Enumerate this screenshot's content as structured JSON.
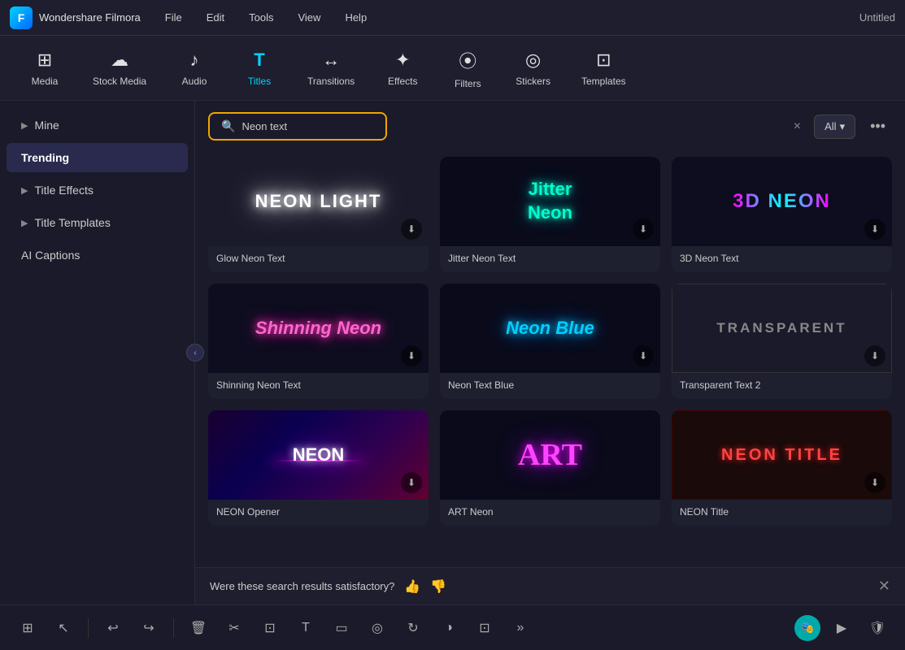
{
  "app": {
    "name": "Wondershare Filmora",
    "window_title": "Untitled"
  },
  "menu": {
    "items": [
      "File",
      "Edit",
      "Tools",
      "View",
      "Help"
    ]
  },
  "toolbar": {
    "items": [
      {
        "id": "media",
        "label": "Media",
        "icon": "⊞"
      },
      {
        "id": "stock-media",
        "label": "Stock Media",
        "icon": "☁"
      },
      {
        "id": "audio",
        "label": "Audio",
        "icon": "♪"
      },
      {
        "id": "titles",
        "label": "Titles",
        "icon": "T",
        "active": true
      },
      {
        "id": "transitions",
        "label": "Transitions",
        "icon": "↔"
      },
      {
        "id": "effects",
        "label": "Effects",
        "icon": "✦"
      },
      {
        "id": "filters",
        "label": "Filters",
        "icon": "⦿"
      },
      {
        "id": "stickers",
        "label": "Stickers",
        "icon": "◎"
      },
      {
        "id": "templates",
        "label": "Templates",
        "icon": "⊡"
      }
    ]
  },
  "sidebar": {
    "items": [
      {
        "id": "mine",
        "label": "Mine",
        "has_chevron": true
      },
      {
        "id": "trending",
        "label": "Trending",
        "active": true
      },
      {
        "id": "title-effects",
        "label": "Title Effects",
        "has_chevron": true
      },
      {
        "id": "title-templates",
        "label": "Title Templates",
        "has_chevron": true
      },
      {
        "id": "ai-captions",
        "label": "AI Captions"
      }
    ]
  },
  "search": {
    "value": "Neon text",
    "placeholder": "Neon text",
    "filter_label": "All",
    "clear_label": "×"
  },
  "grid": {
    "items": [
      {
        "id": "glow-neon",
        "label": "Glow Neon Text",
        "thumb_type": "neon-light"
      },
      {
        "id": "jitter-neon",
        "label": "Jitter Neon Text",
        "thumb_type": "jitter-neon"
      },
      {
        "id": "3d-neon",
        "label": "3D Neon Text",
        "thumb_type": "3d-neon"
      },
      {
        "id": "shinning-neon",
        "label": "Shinning Neon Text",
        "thumb_type": "shinning-neon"
      },
      {
        "id": "neon-blue",
        "label": "Neon Text Blue",
        "thumb_type": "neon-blue"
      },
      {
        "id": "transparent-text",
        "label": "Transparent Text 2",
        "thumb_type": "transparent"
      },
      {
        "id": "neon-opener",
        "label": "NEON Opener",
        "thumb_type": "neon-opener"
      },
      {
        "id": "art-neon",
        "label": "ART Neon",
        "thumb_type": "art"
      },
      {
        "id": "neon-title",
        "label": "NEON Title",
        "thumb_type": "neon-title"
      }
    ]
  },
  "feedback": {
    "text": "Were these search results satisfactory?",
    "thumbs_up": "👍",
    "thumbs_down": "👎"
  },
  "bottom_toolbar": {
    "buttons": [
      {
        "id": "grid-view",
        "icon": "⊞"
      },
      {
        "id": "select",
        "icon": "↖"
      },
      {
        "id": "undo",
        "icon": "↩"
      },
      {
        "id": "redo",
        "icon": "↪"
      },
      {
        "id": "delete",
        "icon": "⊡"
      },
      {
        "id": "cut",
        "icon": "✂"
      },
      {
        "id": "crop",
        "icon": "⊞"
      },
      {
        "id": "text",
        "icon": "T"
      },
      {
        "id": "transform",
        "icon": "▭"
      },
      {
        "id": "mask",
        "icon": "◎"
      },
      {
        "id": "rotate",
        "icon": "↻"
      },
      {
        "id": "palette",
        "icon": "◑"
      },
      {
        "id": "export",
        "icon": "⊡"
      },
      {
        "id": "more",
        "icon": "»"
      }
    ]
  }
}
